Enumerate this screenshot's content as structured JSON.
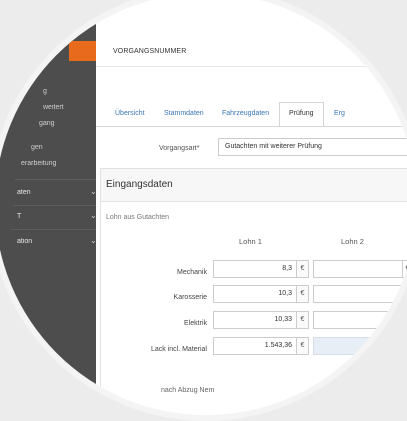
{
  "sidebar": {
    "items": [
      {
        "label": "g",
        "sub": true
      },
      {
        "label": "weitert",
        "sub": true
      },
      {
        "label": "gang",
        "sub": true
      },
      {
        "label": "gen",
        "sub": true
      },
      {
        "label": "erarbeitung",
        "sub": true
      },
      {
        "label": "aten",
        "chevron": "⌄"
      },
      {
        "label": "T",
        "chevron": "⌄"
      },
      {
        "label": "ation",
        "chevron": "⌄"
      }
    ],
    "accent_color": "#e86a1c"
  },
  "header": {
    "title": "VORGANGSNUMMER"
  },
  "tabs": [
    {
      "label": "Übersicht"
    },
    {
      "label": "Stammdaten"
    },
    {
      "label": "Fahrzeugdaten"
    },
    {
      "label": "Prüfung",
      "active": true
    },
    {
      "label": "Erg"
    }
  ],
  "vorgangsart": {
    "label": "Vorgangsart*",
    "value": "Gutachten mit weiterer Prüfung"
  },
  "panel": {
    "title": "Eingangsdaten",
    "section_label": "Lohn aus Gutachten",
    "columns": [
      "Lohn 1",
      "Lohn 2"
    ],
    "currency": "€",
    "rows": [
      {
        "label": "Mechanik",
        "lohn1": "8,3"
      },
      {
        "label": "Karosserie",
        "lohn1": "10,3"
      },
      {
        "label": "Elektrik",
        "lohn1": "10,33"
      },
      {
        "label": "Lack incl. Material",
        "lohn1": "1.543,36"
      }
    ],
    "footer_text": "nach Abzug Nem"
  }
}
